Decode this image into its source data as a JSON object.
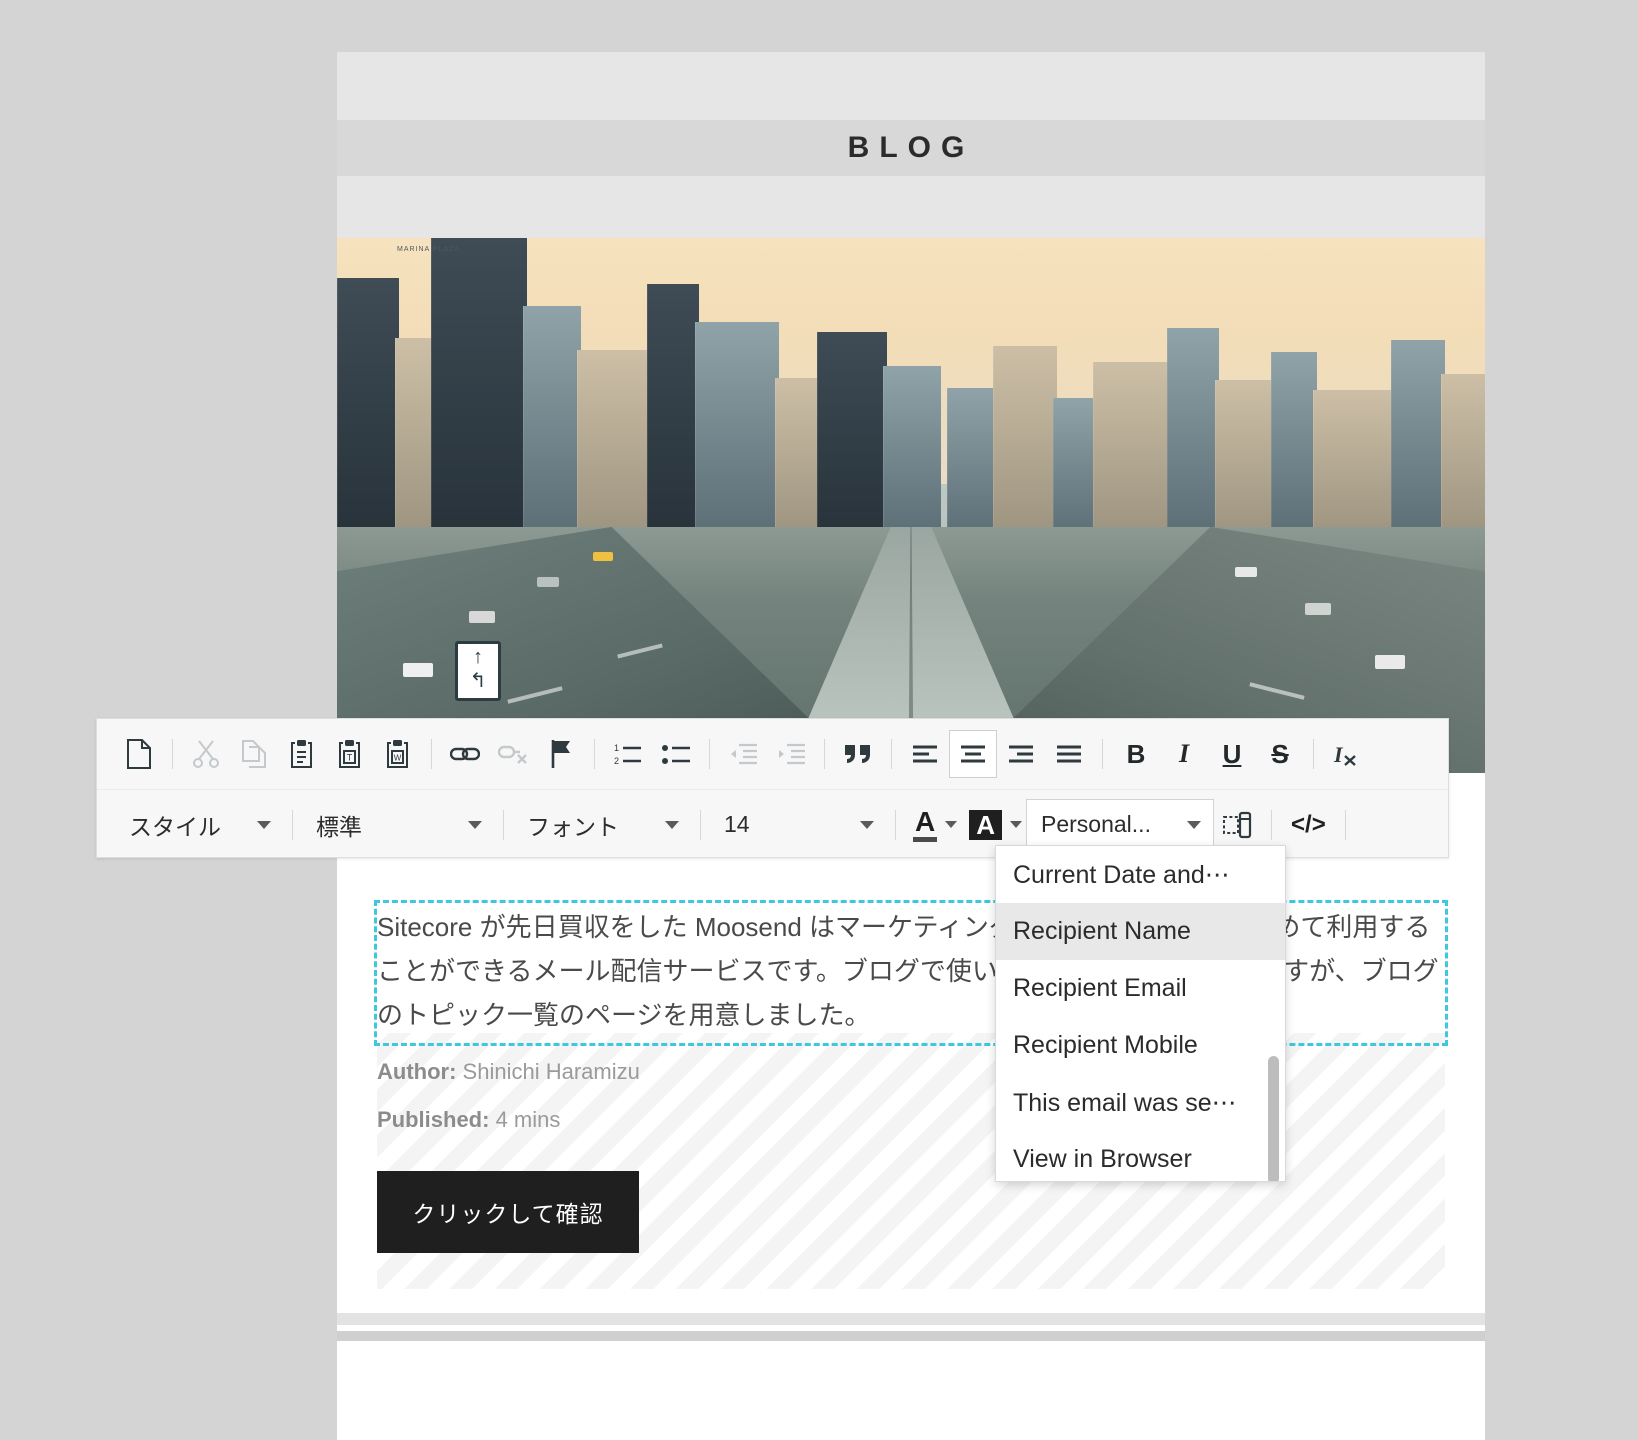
{
  "email": {
    "header_title": "BLOG",
    "hero": {
      "sign_label": "MARINA PLAZA",
      "alt": "city-highway-photo"
    },
    "paragraph": "Sitecore が先日買収をした Moosend はマーケティングオートメーションを含めて利用することができるメール配信サービスです。ブログで使い方などを紹介していきますが、ブログのトピック一覧のページを用意しました。",
    "author_label": "Author:",
    "author_value": "Shinichi Haramizu",
    "published_label": "Published:",
    "published_value": "4 mins",
    "cta_label": "クリックして確認"
  },
  "toolbar": {
    "row1": [
      {
        "name": "new-page-icon",
        "label": "New Page",
        "state": "enabled"
      },
      {
        "name": "cut-icon",
        "label": "Cut",
        "state": "disabled"
      },
      {
        "name": "copy-icon",
        "label": "Copy",
        "state": "disabled"
      },
      {
        "name": "paste-icon",
        "label": "Paste",
        "state": "enabled"
      },
      {
        "name": "paste-as-text-icon",
        "label": "Paste as plain text",
        "state": "enabled"
      },
      {
        "name": "paste-from-word-icon",
        "label": "Paste from Word",
        "state": "enabled"
      },
      {
        "name": "link-icon",
        "label": "Link",
        "state": "enabled"
      },
      {
        "name": "unlink-icon",
        "label": "Unlink",
        "state": "disabled"
      },
      {
        "name": "anchor-flag-icon",
        "label": "Anchor",
        "state": "enabled"
      },
      {
        "name": "numbered-list-icon",
        "label": "Insert/Remove Numbered List",
        "state": "enabled"
      },
      {
        "name": "bulleted-list-icon",
        "label": "Insert/Remove Bulleted List",
        "state": "enabled"
      },
      {
        "name": "decrease-indent-icon",
        "label": "Decrease Indent",
        "state": "disabled"
      },
      {
        "name": "increase-indent-icon",
        "label": "Increase Indent",
        "state": "disabled"
      },
      {
        "name": "blockquote-icon",
        "label": "Block Quote",
        "state": "enabled"
      },
      {
        "name": "align-left-icon",
        "label": "Align Left",
        "state": "enabled"
      },
      {
        "name": "align-center-icon",
        "label": "Center",
        "state": "active"
      },
      {
        "name": "align-right-icon",
        "label": "Align Right",
        "state": "enabled"
      },
      {
        "name": "justify-icon",
        "label": "Justify",
        "state": "enabled"
      },
      {
        "name": "bold-icon",
        "label": "B",
        "state": "enabled"
      },
      {
        "name": "italic-icon",
        "label": "I",
        "state": "enabled"
      },
      {
        "name": "underline-icon",
        "label": "U",
        "state": "enabled"
      },
      {
        "name": "strikethrough-icon",
        "label": "S",
        "state": "enabled"
      },
      {
        "name": "remove-format-icon",
        "label": "Remove Format",
        "state": "enabled"
      }
    ],
    "style_dropdown": "スタイル",
    "format_dropdown": "標準",
    "font_dropdown": "フォント",
    "size_dropdown": "14",
    "text_color_label": "A",
    "bg_color_label": "A",
    "personalization_dropdown": "Personal...",
    "image_icon_label": "insert-image-icon",
    "source_code_label": "</>"
  },
  "personalization_menu": {
    "items": [
      {
        "label": "Current Date and⋯",
        "selected": false
      },
      {
        "label": "Recipient Name",
        "selected": true
      },
      {
        "label": "Recipient Email",
        "selected": false
      },
      {
        "label": "Recipient Mobile",
        "selected": false
      },
      {
        "label": "This email was se⋯",
        "selected": false
      },
      {
        "label": "View in Browser",
        "selected": false
      }
    ]
  },
  "colors": {
    "selection_outline": "#3dc8dd",
    "cta_background": "#1f1f1f",
    "page_background": "#d4d4d4",
    "toolbar_background": "#f7f7f7",
    "menu_selected": "#e8e8e8"
  }
}
